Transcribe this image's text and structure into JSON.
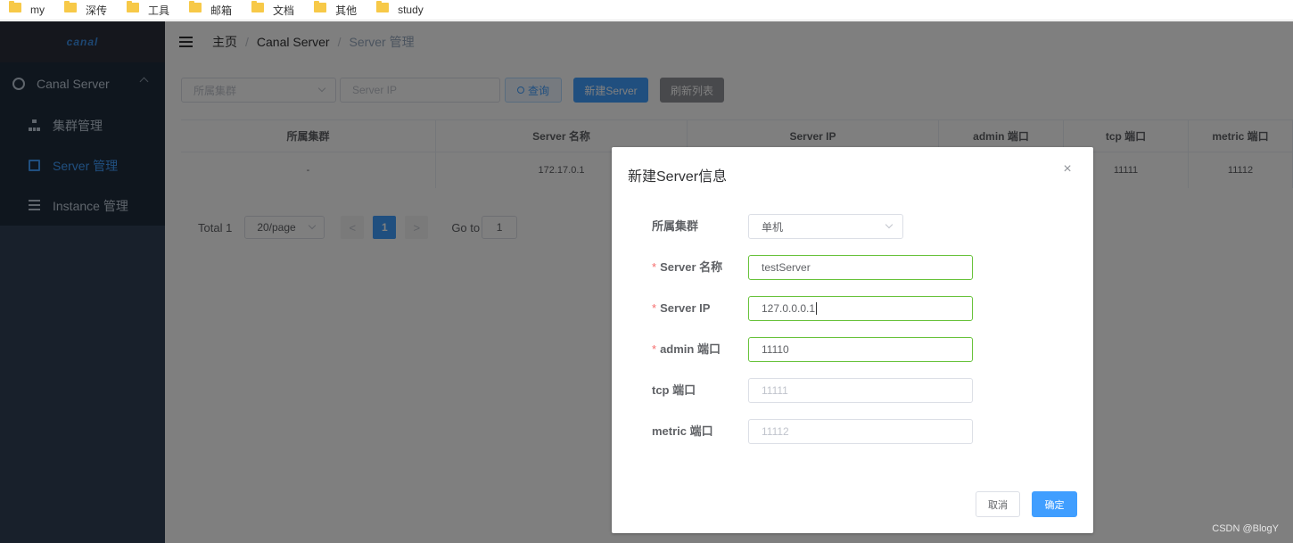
{
  "bookmarks": [
    "my",
    "深传",
    "工具",
    "邮箱",
    "文档",
    "其他",
    "study"
  ],
  "sidebar": {
    "logo": "canal",
    "parent_label": "Canal Server",
    "items": [
      {
        "label": "集群管理"
      },
      {
        "label": "Server 管理"
      },
      {
        "label": "Instance 管理"
      }
    ]
  },
  "breadcrumb": {
    "home": "主页",
    "section": "Canal Server",
    "current": "Server 管理",
    "separator": "/"
  },
  "filters": {
    "cluster_placeholder": "所属集群",
    "ip_placeholder": "Server IP",
    "query_label": "查询",
    "new_label": "新建Server",
    "refresh_label": "刷新列表"
  },
  "table": {
    "headers": [
      "所属集群",
      "Server 名称",
      "Server IP",
      "admin 端口",
      "tcp 端口",
      "metric 端口"
    ],
    "rows": [
      [
        "-",
        "172.17.0.1",
        "",
        "",
        "11111",
        "11112"
      ]
    ]
  },
  "pagination": {
    "total": "Total 1",
    "page_size": "20/page",
    "prev": "<",
    "current": "1",
    "next": ">",
    "goto_label": "Go to",
    "goto_value": "1"
  },
  "dialog": {
    "title": "新建Server信息",
    "close": "×",
    "fields": {
      "cluster": {
        "label": "所属集群",
        "value": "单机"
      },
      "name": {
        "label": "Server 名称",
        "value": "testServer"
      },
      "ip": {
        "label": "Server IP",
        "value": "127.0.0.0.1"
      },
      "admin_port": {
        "label": "admin 端口",
        "value": "11110"
      },
      "tcp_port": {
        "label": "tcp 端口",
        "placeholder": "11111"
      },
      "metric_port": {
        "label": "metric 端口",
        "placeholder": "11112"
      }
    },
    "required_mark": "*",
    "cancel_label": "取消",
    "confirm_label": "确定"
  },
  "watermark": "CSDN @BlogY",
  "colors": {
    "primary": "#409eff",
    "sidebar": "#304156",
    "success_border": "#67c23a",
    "required": "#f56c6c"
  }
}
